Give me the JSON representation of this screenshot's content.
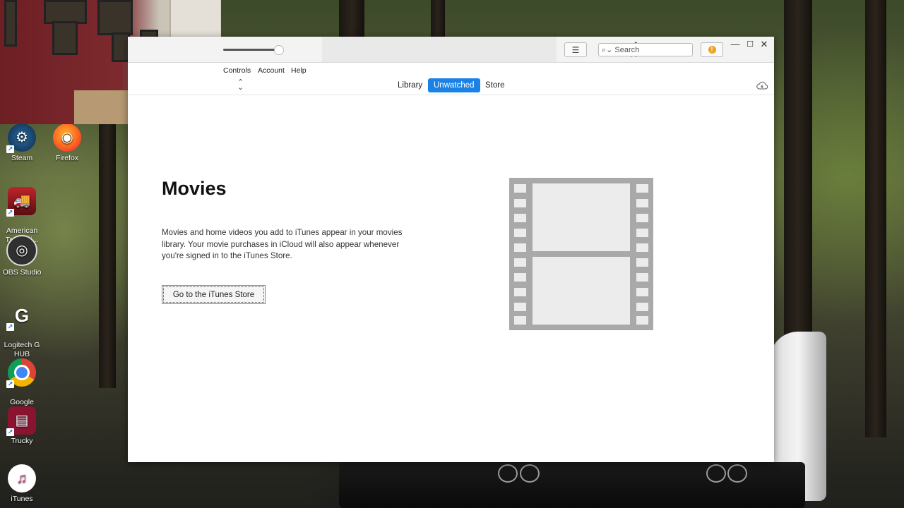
{
  "desktop": {
    "icons": [
      {
        "label": "Steam"
      },
      {
        "label": "Firefox"
      },
      {
        "label": "American\nTruck Si..."
      },
      {
        "label": "OBS Studio"
      },
      {
        "label": "Logitech G\nHUB"
      },
      {
        "label": "Google\nChrome"
      },
      {
        "label": "Trucky"
      },
      {
        "label": "iTunes"
      }
    ]
  },
  "itunes": {
    "toolbar": {
      "search_placeholder": "Search",
      "list_icon": "list-icon",
      "alert_icon": "alert-icon"
    },
    "window_controls": {
      "minimize": "—",
      "maximize": "☐",
      "close": "✕"
    },
    "menu": [
      "Controls",
      "Account",
      "Help"
    ],
    "nav": {
      "stepper": "⌃⌄",
      "tabs": [
        {
          "label": "Library",
          "active": false
        },
        {
          "label": "Unwatched",
          "active": true
        },
        {
          "label": "Store",
          "active": false
        }
      ]
    },
    "content": {
      "title": "Movies",
      "description": "Movies and home videos you add to iTunes appear in your movies library. Your movie purchases in iCloud will also appear whenever you're signed in to the iTunes Store.",
      "button_label": "Go to the iTunes Store"
    },
    "colors": {
      "accent": "#1a82e6",
      "film_gray": "#a9a9a9"
    }
  }
}
